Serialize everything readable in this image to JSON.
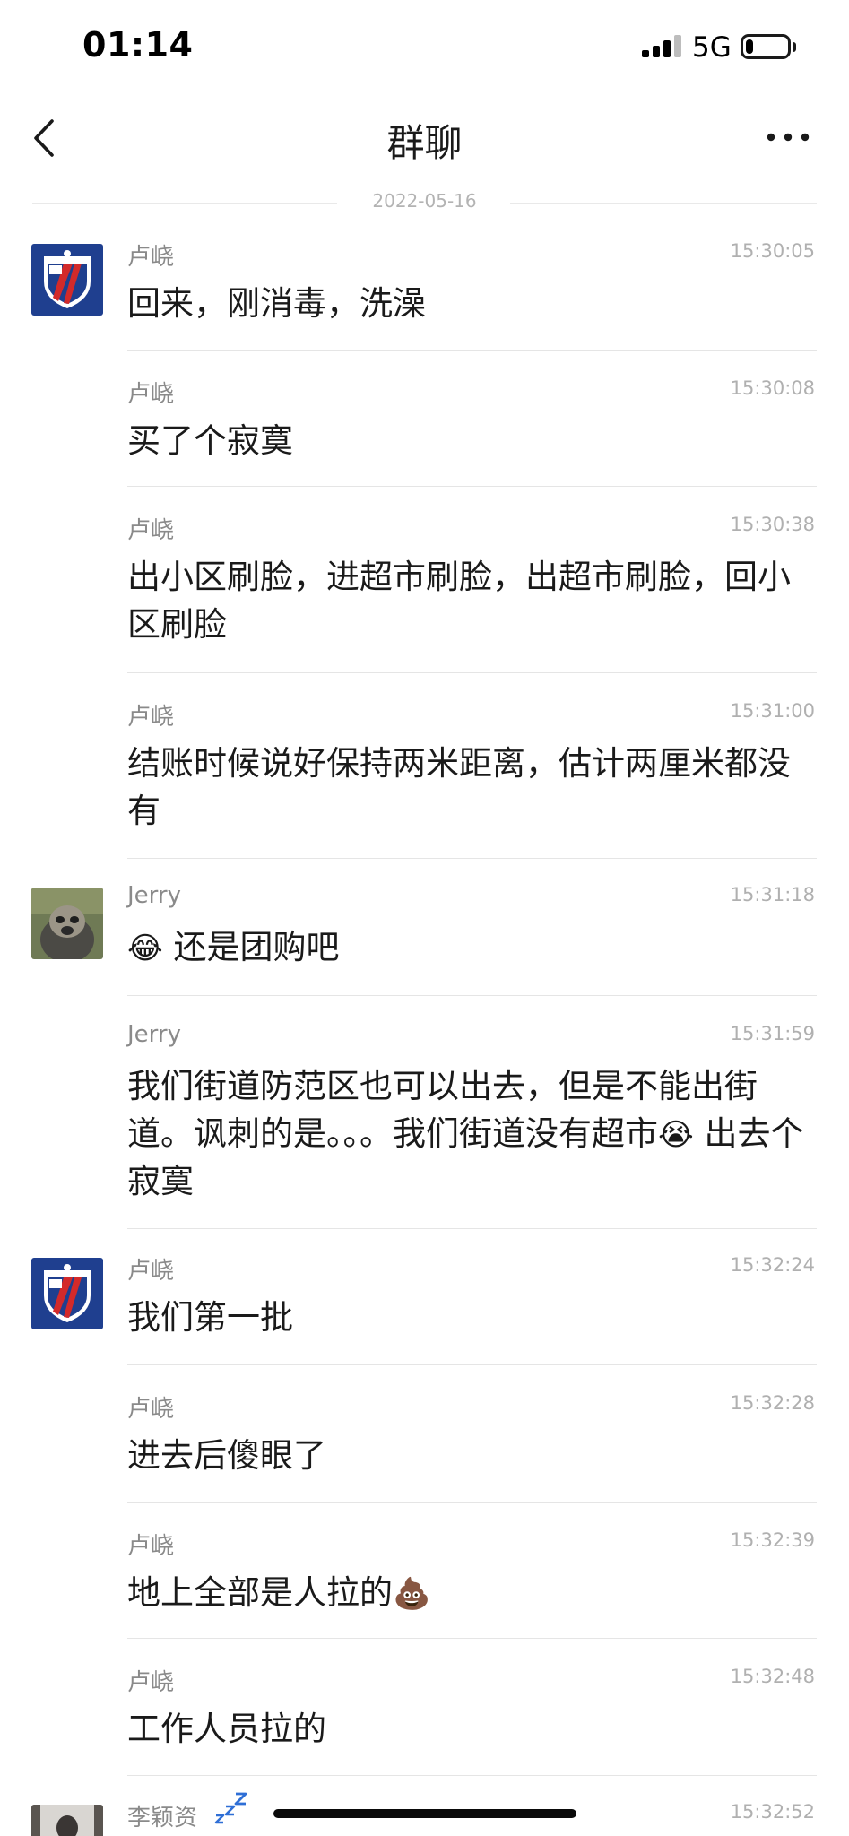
{
  "status_bar": {
    "time": "01:14",
    "network": "5G",
    "battery_level": 0.18
  },
  "nav": {
    "title": "群聊"
  },
  "date_divider": "2022-05-16",
  "colors": {
    "club_blue": "#1f3f8f",
    "club_red": "#d32a2a",
    "text": "#1a1a1a",
    "meta": "#8a8a8a",
    "time": "#b0b0b0"
  },
  "messages": [
    {
      "sender": "卢峣",
      "time": "15:30:05",
      "avatar": "shanghai-shenhua-badge",
      "text": "回来，刚消毒，洗澡"
    },
    {
      "sender": "卢峣",
      "time": "15:30:08",
      "text": "买了个寂寞"
    },
    {
      "sender": "卢峣",
      "time": "15:30:38",
      "text": "出小区刷脸，进超市刷脸，出超市刷脸，回小区刷脸"
    },
    {
      "sender": "卢峣",
      "time": "15:31:00",
      "text": "结账时候说好保持两米距离，估计两厘米都没有"
    },
    {
      "sender": "Jerry",
      "time": "15:31:18",
      "avatar": "animal-photo",
      "emoji": "😂",
      "text": "还是团购吧"
    },
    {
      "sender": "Jerry",
      "time": "15:31:59",
      "text_before": "我们街道防范区也可以出去，但是不能出街道。讽刺的是。。。我们街道没有超市",
      "emoji": "😭",
      "text_after": "出去个寂寞"
    },
    {
      "sender": "卢峣",
      "time": "15:32:24",
      "avatar": "shanghai-shenhua-badge",
      "text": "我们第一批"
    },
    {
      "sender": "卢峣",
      "time": "15:32:28",
      "text": "进去后傻眼了"
    },
    {
      "sender": "卢峣",
      "time": "15:32:39",
      "text": "地上全部是人拉的",
      "emoji": "💩"
    },
    {
      "sender": "卢峣",
      "time": "15:32:48",
      "text": "工作人员拉的"
    },
    {
      "sender": "李颖资",
      "time": "15:32:52",
      "avatar": "person-photo",
      "status_icon": "sleeping-zzz"
    }
  ]
}
